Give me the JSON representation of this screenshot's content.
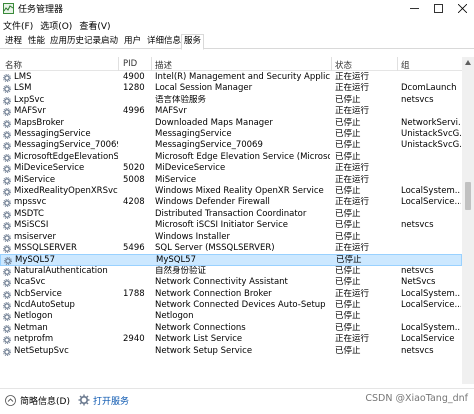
{
  "window": {
    "title": "任务管理器"
  },
  "menu": [
    "文件(F)",
    "选项(O)",
    "查看(V)"
  ],
  "tabs": [
    {
      "label": "进程"
    },
    {
      "label": "性能"
    },
    {
      "label": "应用历史记录"
    },
    {
      "label": "启动"
    },
    {
      "label": "用户"
    },
    {
      "label": "详细信息"
    },
    {
      "label": "服务",
      "active": true
    }
  ],
  "columns": {
    "name": "名称",
    "pid": "PID",
    "description": "描述",
    "status": "状态",
    "group": "组"
  },
  "rows": [
    {
      "name": "LMS",
      "pid": "4900",
      "description": "Intel(R) Management and Security Applicatio...",
      "status": "正在运行",
      "group": ""
    },
    {
      "name": "LSM",
      "pid": "1280",
      "description": "Local Session Manager",
      "status": "正在运行",
      "group": "DcomLaunch"
    },
    {
      "name": "LxpSvc",
      "pid": "",
      "description": "语言体验服务",
      "status": "已停止",
      "group": "netsvcs"
    },
    {
      "name": "MAFSvr",
      "pid": "4996",
      "description": "MAFSvr",
      "status": "正在运行",
      "group": ""
    },
    {
      "name": "MapsBroker",
      "pid": "",
      "description": "Downloaded Maps Manager",
      "status": "已停止",
      "group": "NetworkServi..."
    },
    {
      "name": "MessagingService",
      "pid": "",
      "description": "MessagingService",
      "status": "已停止",
      "group": "UnistackSvcG..."
    },
    {
      "name": "MessagingService_70069",
      "pid": "",
      "description": "MessagingService_70069",
      "status": "已停止",
      "group": "UnistackSvcG..."
    },
    {
      "name": "MicrosoftEdgeElevationS...",
      "pid": "",
      "description": "Microsoft Edge Elevation Service (MicrosoftE...",
      "status": "已停止",
      "group": ""
    },
    {
      "name": "MiDeviceService",
      "pid": "5020",
      "description": "MiDeviceService",
      "status": "正在运行",
      "group": ""
    },
    {
      "name": "MiService",
      "pid": "5008",
      "description": "MiService",
      "status": "正在运行",
      "group": ""
    },
    {
      "name": "MixedRealityOpenXRSvc",
      "pid": "",
      "description": "Windows Mixed Reality OpenXR Service",
      "status": "已停止",
      "group": "LocalSystem..."
    },
    {
      "name": "mpssvc",
      "pid": "4208",
      "description": "Windows Defender Firewall",
      "status": "正在运行",
      "group": "LocalService..."
    },
    {
      "name": "MSDTC",
      "pid": "",
      "description": "Distributed Transaction Coordinator",
      "status": "已停止",
      "group": ""
    },
    {
      "name": "MSiSCSI",
      "pid": "",
      "description": "Microsoft iSCSI Initiator Service",
      "status": "已停止",
      "group": "netsvcs"
    },
    {
      "name": "msiserver",
      "pid": "",
      "description": "Windows Installer",
      "status": "已停止",
      "group": ""
    },
    {
      "name": "MSSQLSERVER",
      "pid": "5496",
      "description": "SQL Server (MSSQLSERVER)",
      "status": "正在运行",
      "group": ""
    },
    {
      "name": "MySQL57",
      "pid": "",
      "description": "MySQL57",
      "status": "已停止",
      "group": "",
      "selected": true
    },
    {
      "name": "NaturalAuthentication",
      "pid": "",
      "description": "自然身份验证",
      "status": "已停止",
      "group": "netsvcs"
    },
    {
      "name": "NcaSvc",
      "pid": "",
      "description": "Network Connectivity Assistant",
      "status": "已停止",
      "group": "NetSvcs"
    },
    {
      "name": "NcbService",
      "pid": "1788",
      "description": "Network Connection Broker",
      "status": "正在运行",
      "group": "LocalSystem..."
    },
    {
      "name": "NcdAutoSetup",
      "pid": "",
      "description": "Network Connected Devices Auto-Setup",
      "status": "已停止",
      "group": "LocalService..."
    },
    {
      "name": "Netlogon",
      "pid": "",
      "description": "Netlogon",
      "status": "已停止",
      "group": ""
    },
    {
      "name": "Netman",
      "pid": "",
      "description": "Network Connections",
      "status": "已停止",
      "group": "LocalSystem..."
    },
    {
      "name": "netprofm",
      "pid": "2940",
      "description": "Network List Service",
      "status": "正在运行",
      "group": "LocalService"
    },
    {
      "name": "NetSetupSvc",
      "pid": "",
      "description": "Network Setup Service",
      "status": "已停止",
      "group": "netsvcs"
    }
  ],
  "status_bar": {
    "less_info": "简略信息(D)",
    "open_services": "打开服务"
  },
  "watermark": "CSDN @XiaoTang_dnf",
  "colors": {
    "selected_row": "#cce8ff",
    "link": "#0b57b0",
    "gear_icon": "#6b7a8f"
  }
}
